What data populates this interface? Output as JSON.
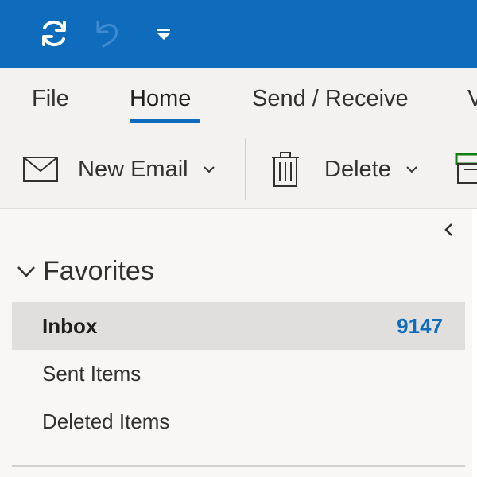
{
  "titlebar": {
    "icons": {
      "sync": "sync-icon",
      "undo": "undo-icon",
      "customize": "customize-quick-access-icon"
    }
  },
  "tabs": [
    {
      "label": "File"
    },
    {
      "label": "Home",
      "selected": true
    },
    {
      "label": "Send / Receive"
    },
    {
      "label": "V"
    }
  ],
  "ribbon": {
    "new_email_label": "New Email",
    "delete_label": "Delete"
  },
  "folders": {
    "favorites_label": "Favorites",
    "items": [
      {
        "label": "Inbox",
        "count": "9147",
        "selected": true
      },
      {
        "label": "Sent Items"
      },
      {
        "label": "Deleted Items"
      }
    ]
  },
  "colors": {
    "accent": "#0f6cbd",
    "ribbon_bg": "#f3f2f1",
    "pane_bg": "#f8f7f6",
    "selected_bg": "#e1dfdd"
  }
}
